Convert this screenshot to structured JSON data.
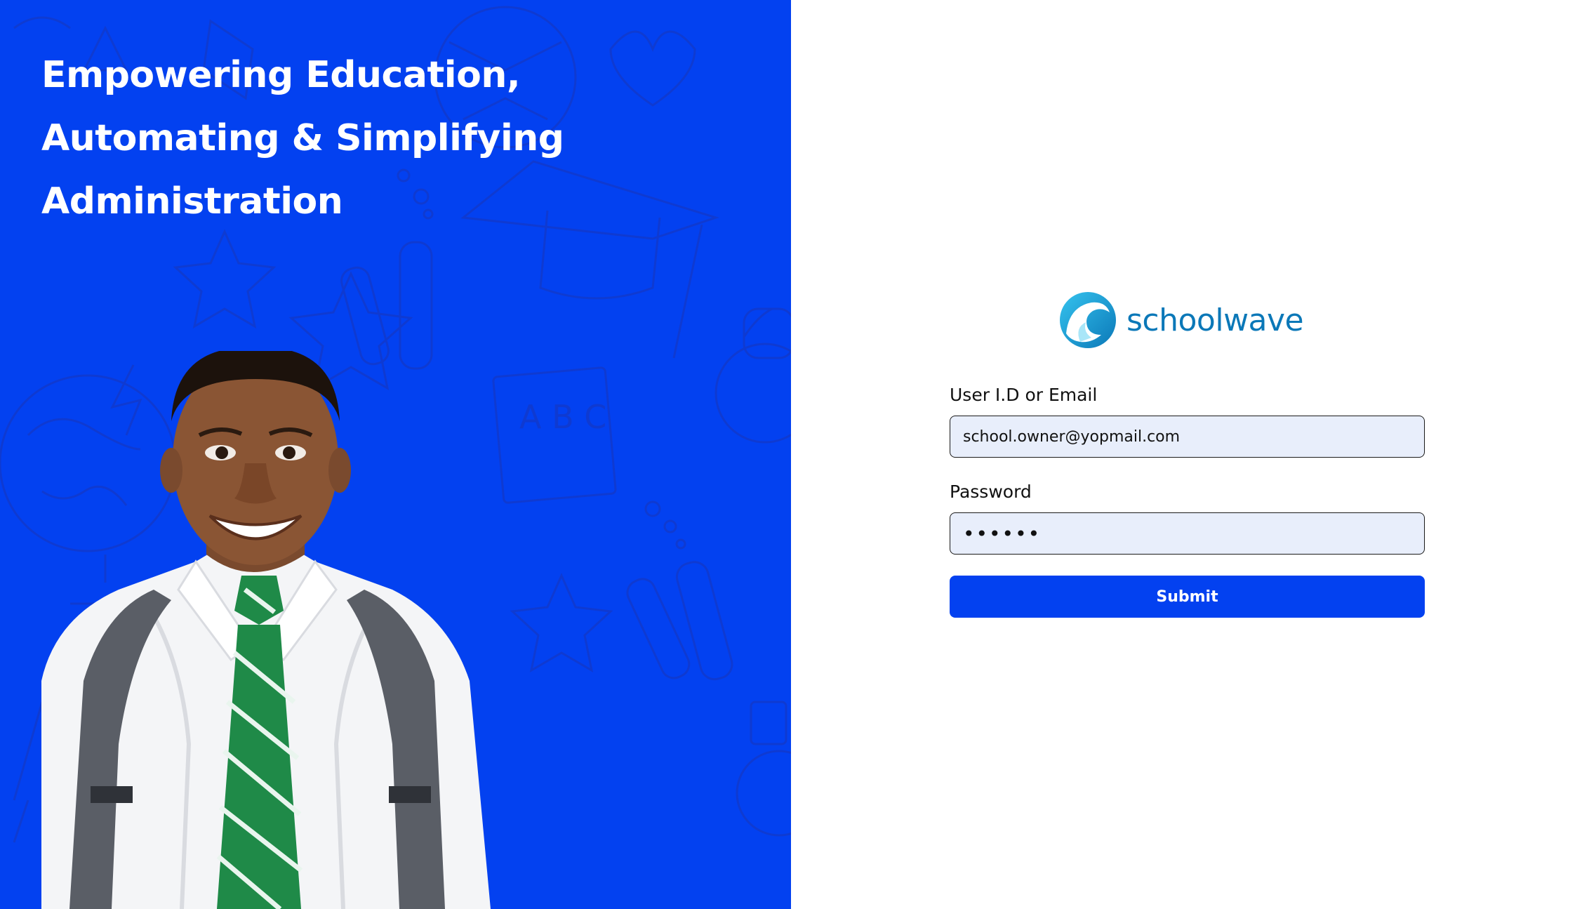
{
  "hero": {
    "heading_lines": [
      "Empowering Education,",
      "Automating & Simplifying",
      "Administration"
    ],
    "background_color": "#0341f0",
    "image": "student-photo"
  },
  "brand": {
    "name": "schoolwave",
    "logo_icon": "wave-logo-icon",
    "color": "#0b78b8"
  },
  "form": {
    "user_label": "User I.D or Email",
    "user_value": "school.owner@yopmail.com",
    "password_label": "Password",
    "password_value": "••••••",
    "submit_label": "Submit"
  }
}
